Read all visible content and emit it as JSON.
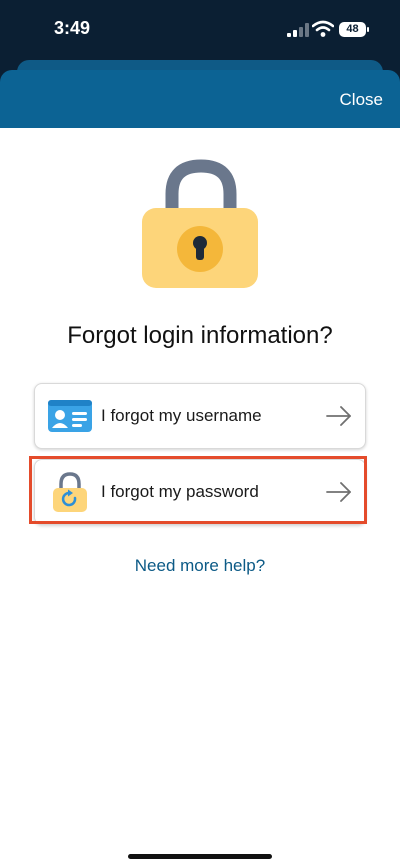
{
  "status_bar": {
    "time": "3:49",
    "battery": "48"
  },
  "header": {
    "close_label": "Close"
  },
  "main": {
    "title": "Forgot login information?",
    "options": [
      {
        "label": "I forgot my username",
        "icon": "id-card-icon"
      },
      {
        "label": "I forgot my password",
        "icon": "lock-refresh-icon",
        "highlighted": true
      }
    ],
    "help_link": "Need more help?"
  },
  "colors": {
    "header": "#0c6394",
    "highlight": "#e44b2b",
    "link": "#0c5a86",
    "lock_body": "#fdd57a",
    "lock_shackle": "#6a778c"
  }
}
